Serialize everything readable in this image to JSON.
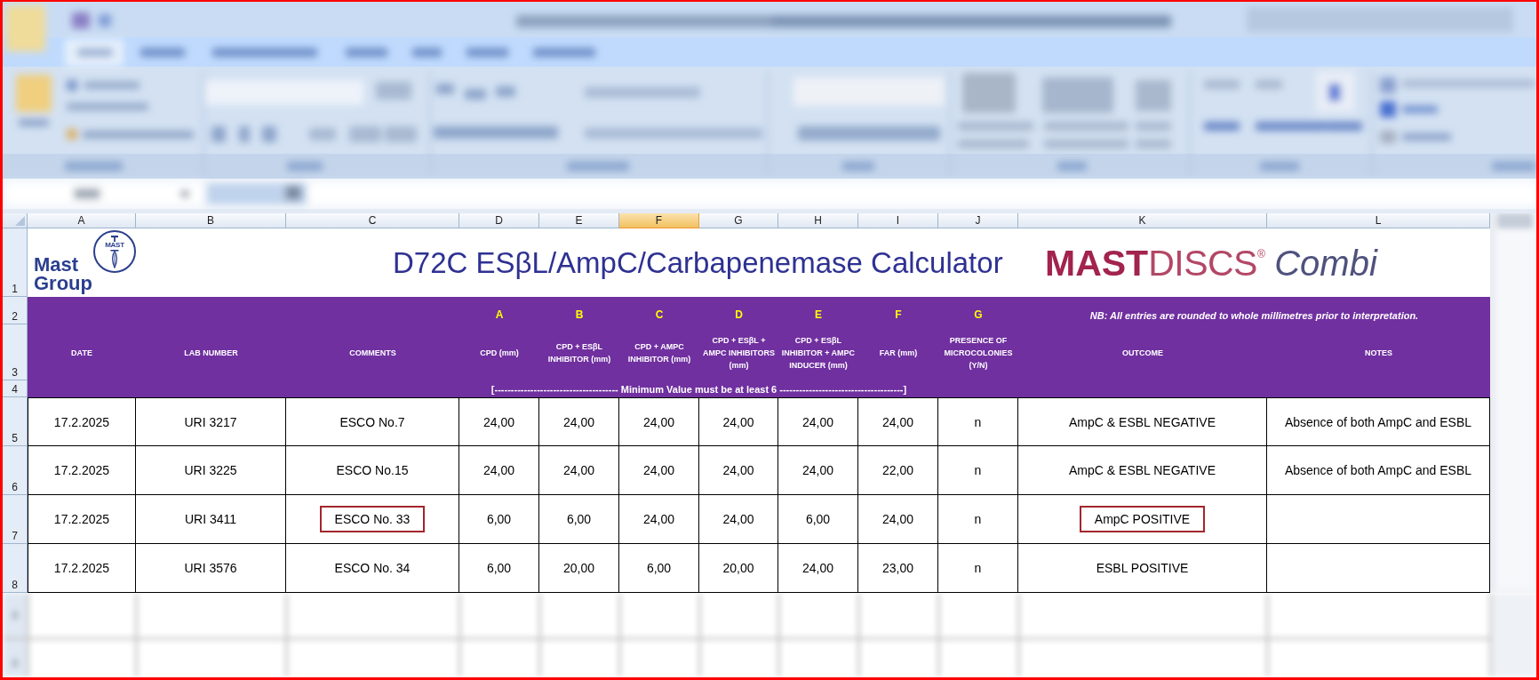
{
  "sheet": {
    "column_headers": [
      {
        "label": "A",
        "selected": false
      },
      {
        "label": "B",
        "selected": false
      },
      {
        "label": "C",
        "selected": false
      },
      {
        "label": "D",
        "selected": false
      },
      {
        "label": "E",
        "selected": false
      },
      {
        "label": "F",
        "selected": true
      },
      {
        "label": "G",
        "selected": false
      },
      {
        "label": "H",
        "selected": false
      },
      {
        "label": "I",
        "selected": false
      },
      {
        "label": "J",
        "selected": false
      },
      {
        "label": "K",
        "selected": false
      },
      {
        "label": "L",
        "selected": false
      }
    ],
    "row_headers": [
      "1",
      "2",
      "3",
      "4",
      "5",
      "6",
      "7",
      "8"
    ]
  },
  "logo": {
    "name": "Mast Group",
    "emblem_text": "MAST"
  },
  "title": "D72C ESβL/AmpC/Carbapenemase Calculator",
  "brand": "**MAST**DISCS$^{®}$ *Combi*",
  "header": {
    "disc_letters": [
      "A",
      "B",
      "C",
      "D",
      "E",
      "F",
      "G"
    ],
    "note": "NB: All entries are rounded to whole millimetres prior to interpretation.",
    "columns": [
      "DATE",
      "LAB NUMBER",
      "COMMENTS",
      "CPD (mm)",
      "CPD + ESβL INHIBITOR (mm)",
      "CPD + AMPC INHIBITOR (mm)",
      "CPD + ESβL + AMPC INHIBITORS (mm)",
      "CPD + ESβL INHIBITOR + AMPC INDUCER (mm)",
      "FAR (mm)",
      "PRESENCE OF MICROCOLONIES (Y/N)",
      "OUTCOME",
      "NOTES"
    ],
    "range_note": "[-------------------------------------- Minimum Value must be at least 6 --------------------------------------]"
  },
  "rows": [
    {
      "cells": [
        {
          "text": "17.2.2025",
          "marked": false
        },
        {
          "text": "URI 3217",
          "marked": false
        },
        {
          "text": "ESCO No.7",
          "marked": false
        },
        {
          "text": "24,00",
          "marked": false
        },
        {
          "text": "24,00",
          "marked": false
        },
        {
          "text": "24,00",
          "marked": false
        },
        {
          "text": "24,00",
          "marked": false
        },
        {
          "text": "24,00",
          "marked": false
        },
        {
          "text": "24,00",
          "marked": false
        },
        {
          "text": "n",
          "marked": false
        },
        {
          "text": "AmpC & ESBL NEGATIVE",
          "marked": false
        },
        {
          "text": "Absence of both AmpC and ESBL",
          "marked": false
        }
      ]
    },
    {
      "cells": [
        {
          "text": "17.2.2025",
          "marked": false
        },
        {
          "text": "URI 3225",
          "marked": false
        },
        {
          "text": "ESCO No.15",
          "marked": false
        },
        {
          "text": "24,00",
          "marked": false
        },
        {
          "text": "24,00",
          "marked": false
        },
        {
          "text": "24,00",
          "marked": false
        },
        {
          "text": "24,00",
          "marked": false
        },
        {
          "text": "24,00",
          "marked": false
        },
        {
          "text": "22,00",
          "marked": false
        },
        {
          "text": "n",
          "marked": false
        },
        {
          "text": "AmpC & ESBL NEGATIVE",
          "marked": false
        },
        {
          "text": "Absence of both AmpC and ESBL",
          "marked": false
        }
      ]
    },
    {
      "cells": [
        {
          "text": "17.2.2025",
          "marked": false
        },
        {
          "text": "URI 3411",
          "marked": false
        },
        {
          "text": "ESCO No. 33",
          "marked": true
        },
        {
          "text": "6,00",
          "marked": false
        },
        {
          "text": "6,00",
          "marked": false
        },
        {
          "text": "24,00",
          "marked": false
        },
        {
          "text": "24,00",
          "marked": false
        },
        {
          "text": "6,00",
          "marked": false
        },
        {
          "text": "24,00",
          "marked": false
        },
        {
          "text": "n",
          "marked": false
        },
        {
          "text": "AmpC POSITIVE",
          "marked": true
        },
        {
          "marked": false
        }
      ]
    },
    {
      "cells": [
        {
          "text": "17.2.2025",
          "marked": false
        },
        {
          "text": "URI 3576",
          "marked": false
        },
        {
          "text": "ESCO No. 34",
          "marked": false
        },
        {
          "text": "6,00",
          "marked": false
        },
        {
          "text": "20,00",
          "marked": false
        },
        {
          "text": "6,00",
          "marked": false
        },
        {
          "text": "20,00",
          "marked": false
        },
        {
          "text": "24,00",
          "marked": false
        },
        {
          "text": "23,00",
          "marked": false
        },
        {
          "text": "n",
          "marked": false
        },
        {
          "text": "ESBL POSITIVE",
          "marked": false
        },
        {
          "marked": false
        }
      ]
    }
  ]
}
